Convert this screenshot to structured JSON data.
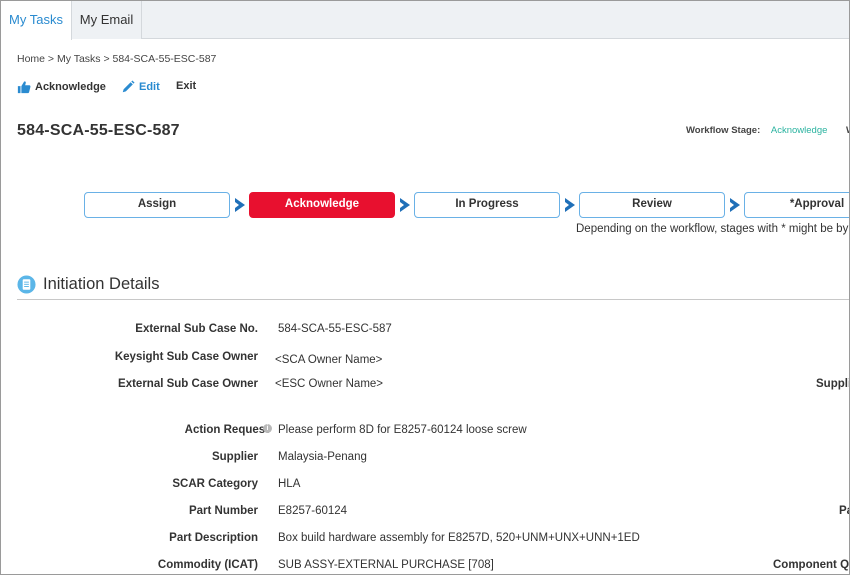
{
  "tabs": [
    {
      "label": "My Tasks",
      "active": true
    },
    {
      "label": "My Email",
      "active": false
    }
  ],
  "breadcrumb": "Home > My Tasks > 584-SCA-55-ESC-587",
  "toolbar": {
    "acknowledge_label": "Acknowledge",
    "edit_label": "Edit",
    "exit_label": "Exit"
  },
  "page_title": "584-SCA-55-ESC-587",
  "workflow": {
    "stage_label": "Workflow Stage:",
    "stage_value": "Acknowledge",
    "truncated_next": "W"
  },
  "stages": [
    "Assign",
    "Acknowledge",
    "In Progress",
    "Review",
    "*Approval"
  ],
  "current_stage": "Acknowledge",
  "stage_note": "Depending on the workflow, stages with * might be by",
  "section": {
    "title": "Initiation Details"
  },
  "fields": [
    {
      "label": "External Sub Case No.",
      "value": "584-SCA-55-ESC-587"
    },
    {
      "label": "Keysight Sub Case Owner",
      "value": "<SCA Owner Name>"
    },
    {
      "label": "External Sub Case Owner",
      "value": "<ESC Owner Name>"
    },
    {
      "label": "Action Request",
      "value": "Please perform 8D for E8257-60124 loose screw"
    },
    {
      "label": "Supplier",
      "value": "Malaysia-Penang"
    },
    {
      "label": "SCAR Category",
      "value": "HLA"
    },
    {
      "label": "Part Number",
      "value": "E8257-60124"
    },
    {
      "label": "Part Description",
      "value": "Box build hardware assembly for E8257D, 520+UNM+UNX+UNN+1ED"
    },
    {
      "label": "Commodity (ICAT)",
      "value": "SUB ASSY-EXTERNAL PURCHASE [708]"
    }
  ],
  "right_labels": {
    "supplier_truncated": "Suppli",
    "part_truncated": "Pa",
    "component_truncated": "Component Q"
  },
  "colors": {
    "accent_blue": "#2a8bd0",
    "current_stage_red": "#e8102f",
    "stage_border": "#6ab1e6",
    "stage_value_teal": "#2bb3a0"
  },
  "icons": {
    "acknowledge": "thumbs-up-icon",
    "edit": "pencil-icon",
    "section": "document-icon",
    "info": "info-icon"
  }
}
